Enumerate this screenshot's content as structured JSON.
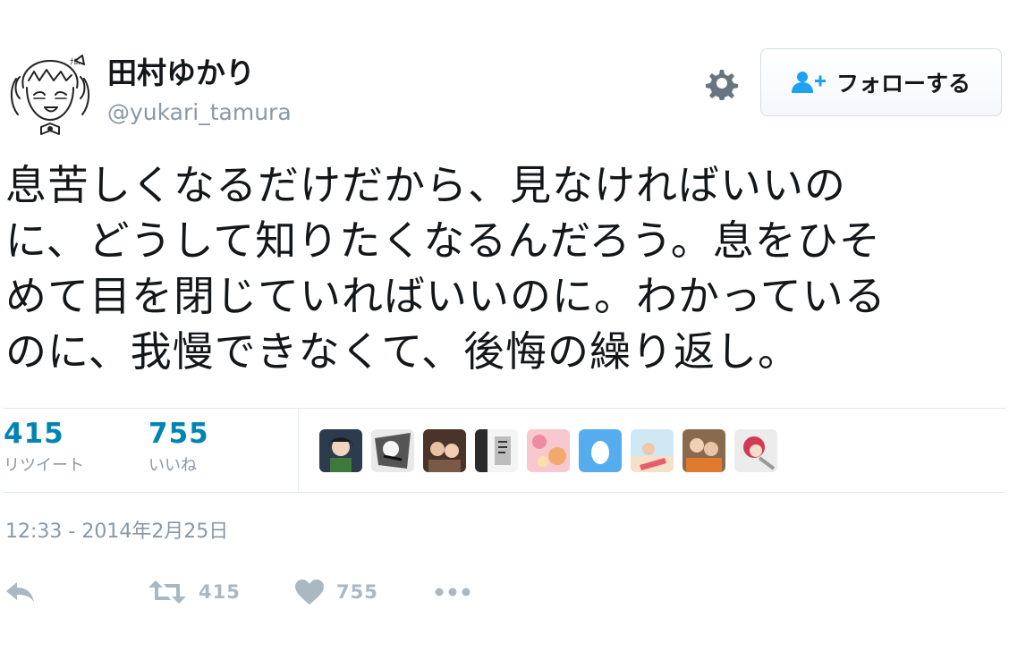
{
  "user": {
    "display_name": "田村ゆかり",
    "handle": "@yukari_tamura"
  },
  "header": {
    "follow_label": "フォローする"
  },
  "tweet": {
    "text": "息苦しくなるだけだから、見なければいいの\nに、どうして知りたくなるんだろう。息をひそ\nめて目を閉じていればいいのに。わかっている\nのに、我慢できなくて、後悔の繰り返し。",
    "timestamp": "12:33 - 2014年2月25日"
  },
  "stats": {
    "retweets": {
      "count": "415",
      "label": "リツイート"
    },
    "likes": {
      "count": "755",
      "label": "いいね"
    }
  },
  "actions": {
    "retweet_count": "415",
    "like_count": "755"
  },
  "colors": {
    "link_blue": "#0084b4",
    "muted_gray": "#8899a6",
    "icon_gray": "#aab8c2",
    "text_dark": "#14171a",
    "follow_icon_blue": "#1da1f2"
  }
}
